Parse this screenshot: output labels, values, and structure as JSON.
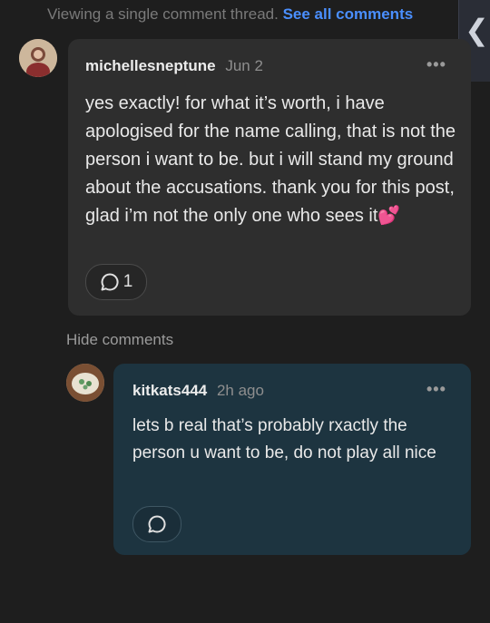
{
  "banner": {
    "text": "Viewing a single comment thread.",
    "link": "See all comments"
  },
  "side_tab": {
    "icon": "chevron-left-icon"
  },
  "comment": {
    "username": "michellesneptune",
    "time": "Jun 2",
    "more_icon": "more-dots-icon",
    "body": "yes exactly! for what it’s worth, i have apologised for the name calling, that is not the person i want to be. but i will stand my ground about the accusations. thank you for this post, glad i’m not the only one who sees it",
    "emoji": "💕",
    "reply_count": "1",
    "reply_icon": "speech-bubble-icon"
  },
  "hide_comments": "Hide comments",
  "reply": {
    "username": "kitkats444",
    "time": "2h ago",
    "more_icon": "more-dots-icon",
    "body": "lets b real that’s probably rxactly the person u want to be, do not play all nice",
    "reply_icon": "speech-bubble-icon"
  },
  "colors": {
    "background": "#1e1e1e",
    "comment_bubble": "#2e2e2e",
    "reply_bubble": "#1d3440",
    "link": "#4a8fff"
  }
}
